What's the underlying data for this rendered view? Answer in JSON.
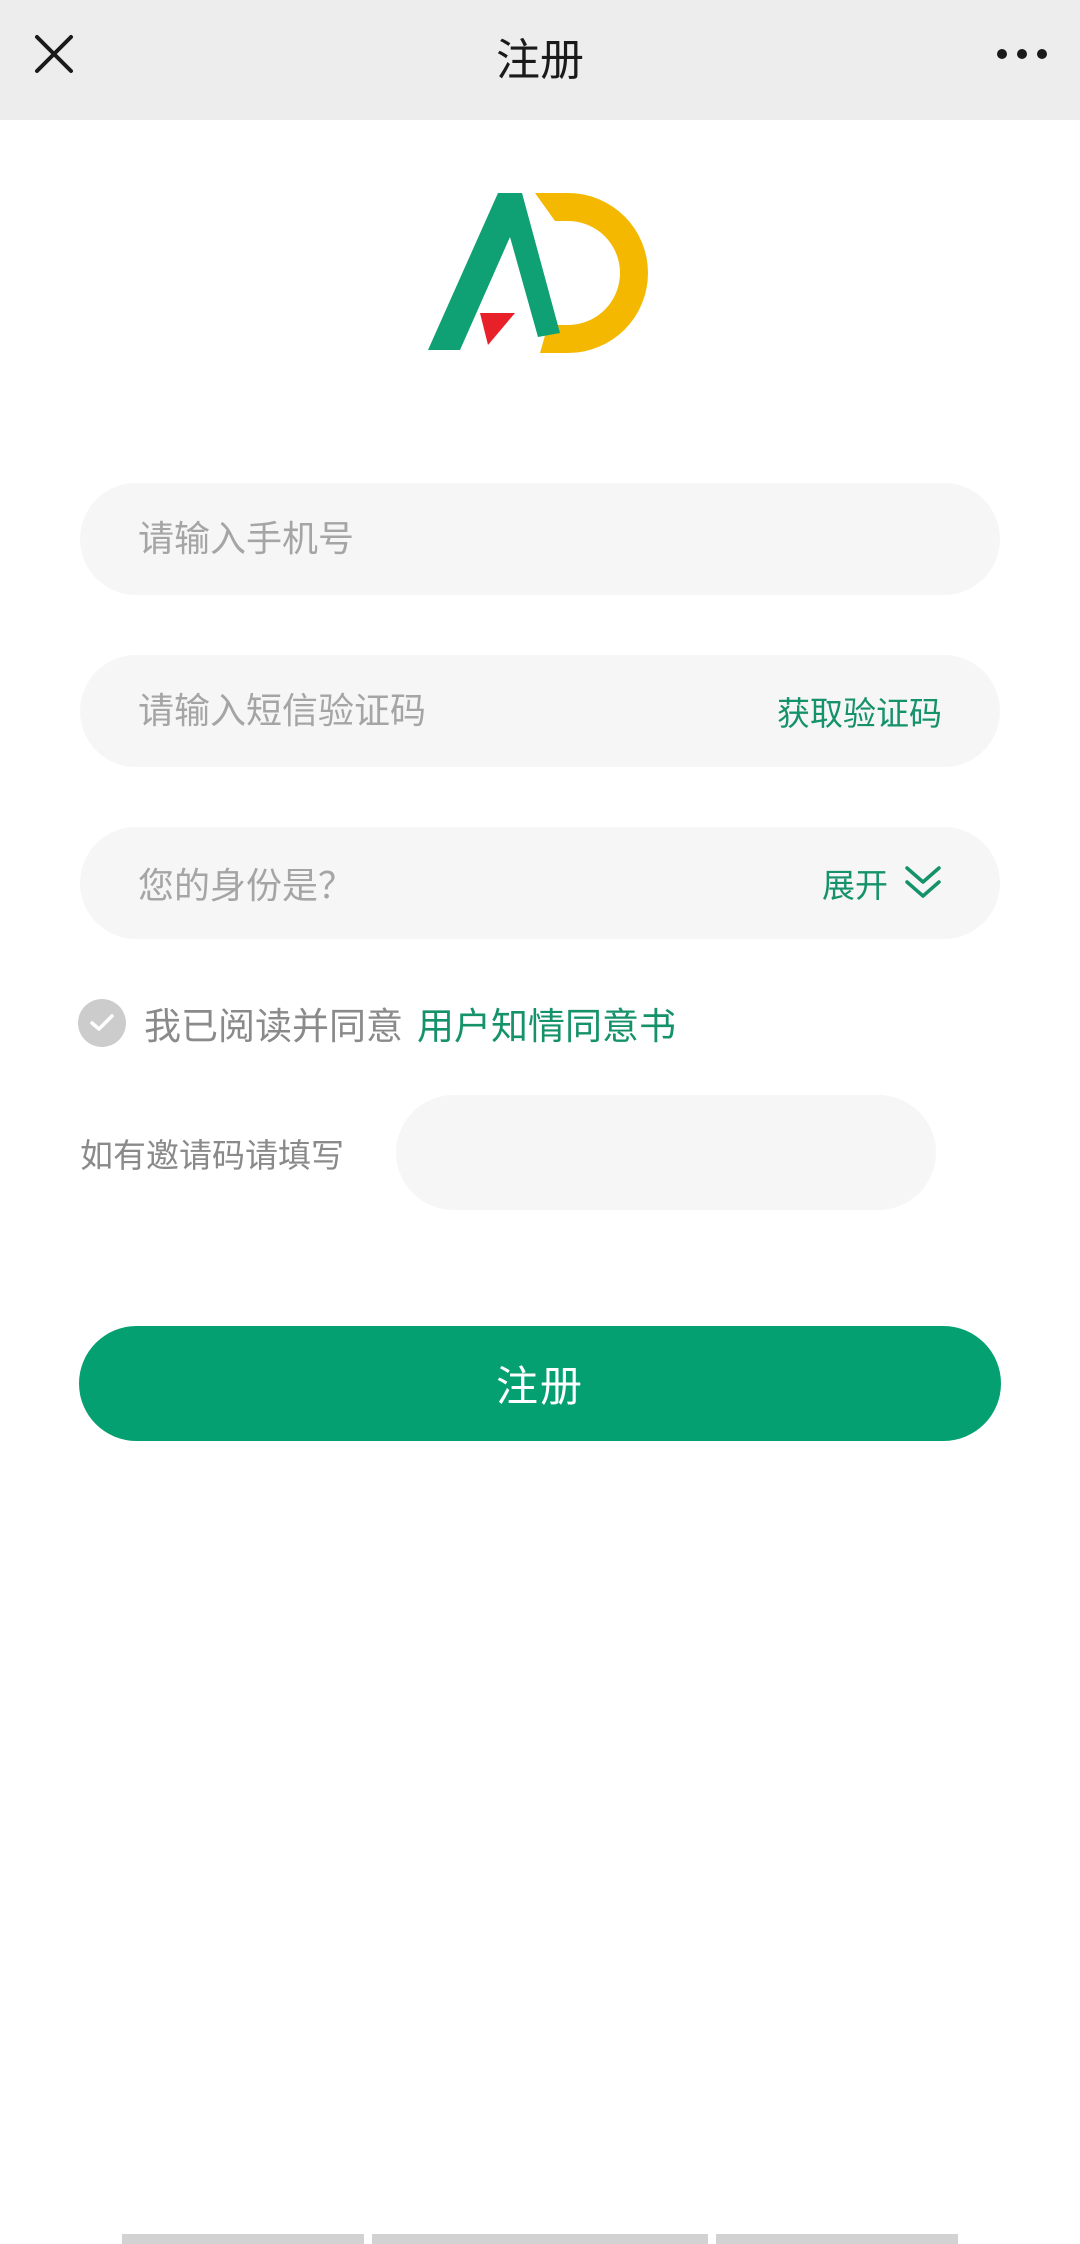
{
  "header": {
    "title": "注册"
  },
  "form": {
    "phone": {
      "placeholder": "请输入手机号",
      "value": ""
    },
    "sms_code": {
      "placeholder": "请输入短信验证码",
      "value": "",
      "get_code_label": "获取验证码"
    },
    "role": {
      "placeholder": "您的身份是？",
      "expand_label": "展开"
    },
    "agreement": {
      "text": "我已阅读并同意",
      "link": "用户知情同意书",
      "checked": true
    },
    "invite": {
      "label": "如有邀请码请填写",
      "value": ""
    },
    "submit_label": "注册"
  },
  "colors": {
    "accent": "#15926a",
    "primary_button": "#04a071",
    "input_bg": "#f6f6f6",
    "header_bg": "#ededed",
    "logo_green": "#0fa073",
    "logo_yellow": "#f5b800",
    "logo_red": "#e8202a"
  },
  "icons": {
    "close": "close-icon",
    "more": "more-dots-icon",
    "expand": "chevron-double-down-icon",
    "check": "check-icon"
  }
}
